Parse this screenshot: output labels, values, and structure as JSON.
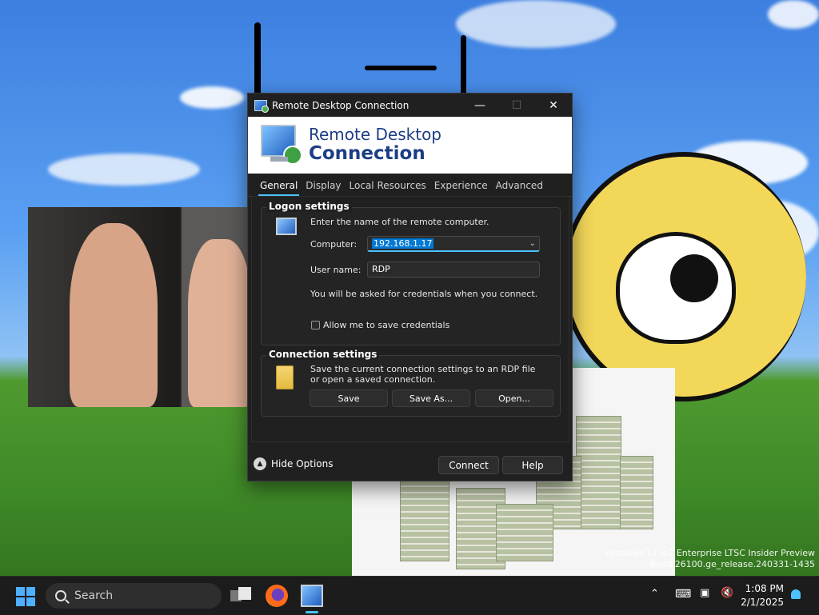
{
  "dialog": {
    "window_title": "Remote Desktop Connection",
    "banner_line1": "Remote Desktop",
    "banner_line2": "Connection",
    "tabs": [
      "General",
      "Display",
      "Local Resources",
      "Experience",
      "Advanced"
    ],
    "active_tab": "General",
    "logon": {
      "title": "Logon settings",
      "instruction": "Enter the name of the remote computer.",
      "computer_label": "Computer:",
      "computer_value": "192.168.1.17",
      "username_label": "User name:",
      "username_value": "RDP",
      "credentials_note": "You will be asked for credentials when you connect.",
      "save_credentials_label": "Allow me to save credentials",
      "save_credentials_checked": false
    },
    "connection": {
      "title": "Connection settings",
      "description": "Save the current connection settings to an RDP file or open a saved connection.",
      "save_label": "Save",
      "save_as_label": "Save As...",
      "open_label": "Open..."
    },
    "hide_options_label": "Hide Options",
    "connect_label": "Connect",
    "help_label": "Help"
  },
  "desktop": {
    "watermark_line1": "Windows 11 IoT Enterprise LTSC Insider Preview",
    "watermark_line2": "Build 26100.ge_release.240331-1435"
  },
  "taskbar": {
    "search_placeholder": "Search",
    "time": "1:08 PM",
    "date": "2/1/2025",
    "accent_color": "#4cc2ff"
  }
}
